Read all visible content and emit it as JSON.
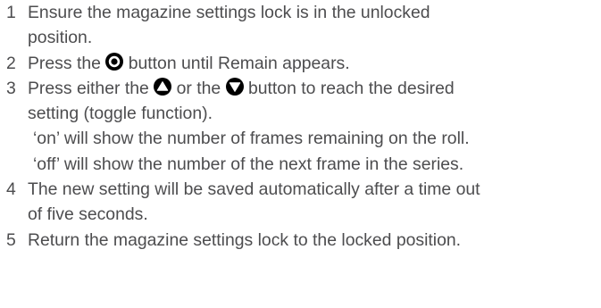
{
  "steps": [
    {
      "number": "1",
      "line1": "Ensure the magazine settings lock is in the unlocked",
      "line2": "position."
    },
    {
      "number": "2",
      "before_icon": "Press the",
      "icon": "select-button-icon",
      "after_icon": "button until Remain appears."
    },
    {
      "number": "3",
      "before_icon1": "Press either the",
      "icon1": "up-arrow-button-icon",
      "between_icons": "or the",
      "icon2": "down-arrow-button-icon",
      "after_icon2": "button to reach the desired",
      "line2": "setting (toggle function).",
      "note_on": "‘on’ will show the number of frames remaining on the roll.",
      "note_off": "‘off’ will show the number of the next frame in the series."
    },
    {
      "number": "4",
      "line1": "The new setting will be saved automatically after a time out",
      "line2": "of five seconds."
    },
    {
      "number": "5",
      "line1": "Return the magazine settings lock to the locked position."
    }
  ],
  "colors": {
    "text": "#4d4d4f",
    "icon": "#000000"
  }
}
